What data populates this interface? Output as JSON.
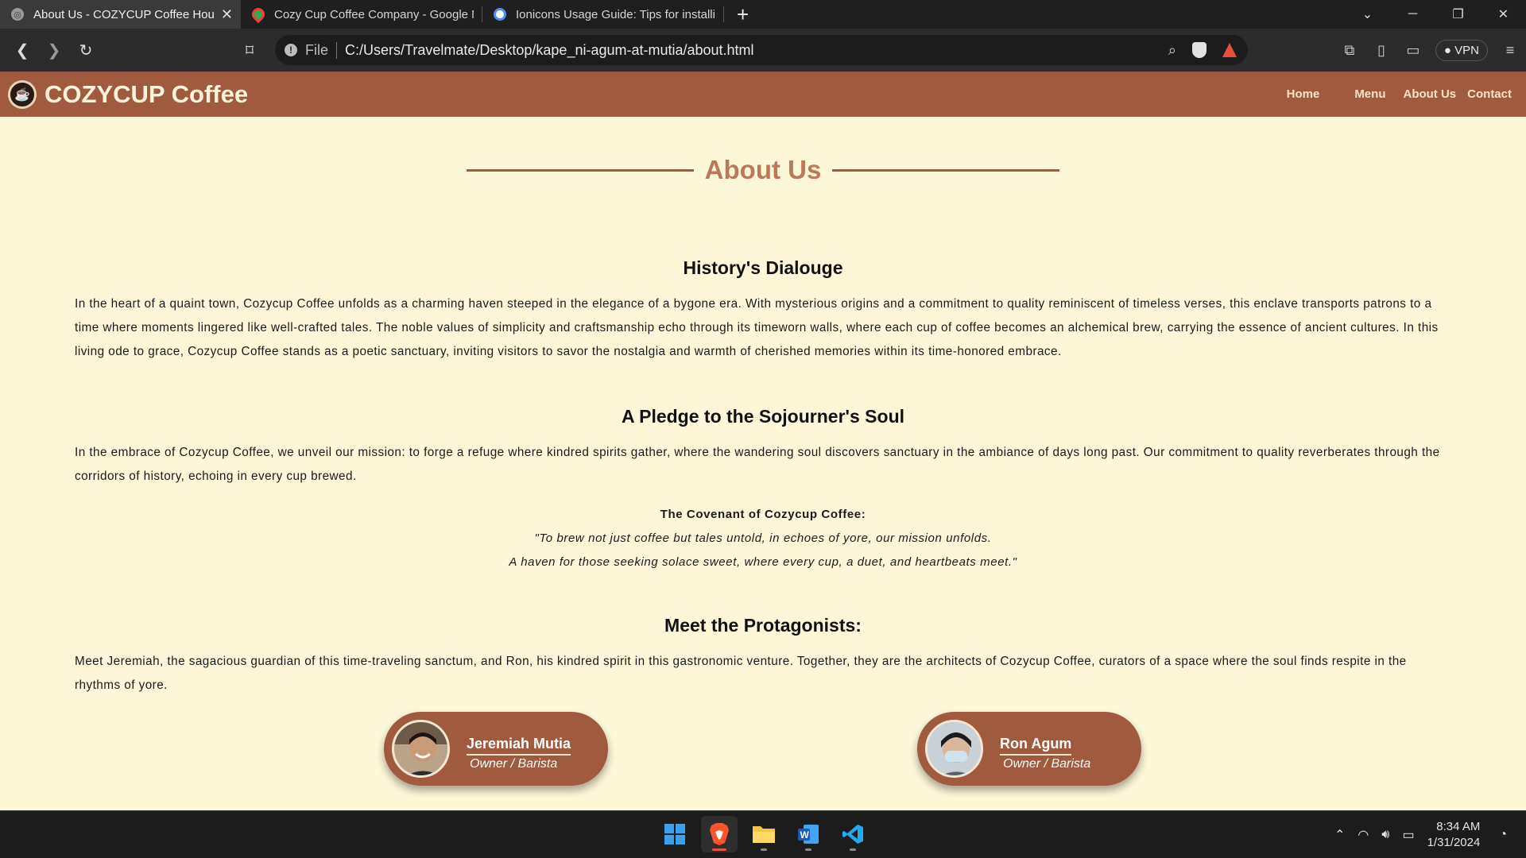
{
  "browser": {
    "tabs": [
      {
        "title": "About Us - COZYCUP Coffee House",
        "active": true
      },
      {
        "title": "Cozy Cup Coffee Company - Google Maps",
        "active": false
      },
      {
        "title": "Ionicons Usage Guide: Tips for installing",
        "active": false
      }
    ],
    "address": {
      "scheme_label": "File",
      "url": "C:/Users/Travelmate/Desktop/kape_ni-agum-at-mutia/about.html"
    },
    "vpn_label": "VPN"
  },
  "site": {
    "brand": "COZYCUP Coffee",
    "nav": [
      "Home",
      "Menu",
      "About Us",
      "Contact"
    ],
    "colors": {
      "nav_bg": "#a05a3e",
      "page_bg": "#fdf7d7",
      "title": "#b87a5a"
    }
  },
  "page": {
    "title": "About Us",
    "history": {
      "heading": "History's Dialouge",
      "text": "In the heart of a quaint town, Cozycup Coffee unfolds as a charming haven steeped in the elegance of a bygone era. With mysterious origins and a commitment to quality reminiscent of timeless verses, this enclave transports patrons to a time where moments lingered like well-crafted tales. The noble values of simplicity and craftsmanship echo through its timeworn walls, where each cup of coffee becomes an alchemical brew, carrying the essence of ancient cultures. In this living ode to grace, Cozycup Coffee stands as a poetic sanctuary, inviting visitors to savor the nostalgia and warmth of cherished memories within its time-honored embrace."
    },
    "pledge": {
      "heading": "A Pledge to the Sojourner's Soul",
      "text": "In the embrace of Cozycup Coffee, we unveil our mission: to forge a refuge where kindred spirits gather, where the wandering soul discovers sanctuary in the ambiance of days long past. Our commitment to quality reverberates through the corridors of history, echoing in every cup brewed.",
      "covenant_title": "The Covenant of Cozycup Coffee:",
      "covenant_line1": "\"To brew not just coffee but tales untold, in echoes of yore, our mission unfolds.",
      "covenant_line2": "A haven for those seeking solace sweet, where every cup, a duet, and heartbeats meet.\""
    },
    "protagonists": {
      "heading": "Meet the Protagonists:",
      "text": "Meet Jeremiah, the sagacious guardian of this time-traveling sanctum, and Ron, his kindred spirit in this gastronomic venture. Together, they are the architects of Cozycup Coffee, curators of a space where the soul finds respite in the rhythms of yore.",
      "people": [
        {
          "name": "Jeremiah Mutia",
          "role": "Owner / Barista"
        },
        {
          "name": "Ron Agum",
          "role": "Owner / Barista"
        }
      ]
    }
  },
  "taskbar": {
    "time": "8:34 AM",
    "date": "1/31/2024"
  }
}
